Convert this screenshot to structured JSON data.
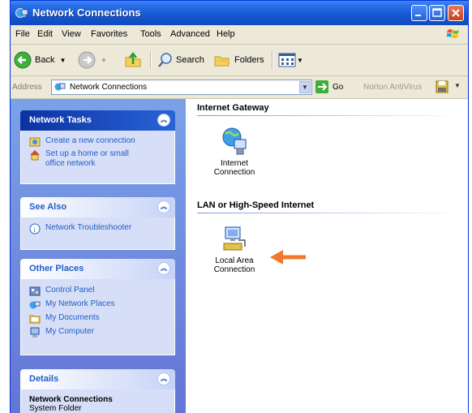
{
  "window": {
    "title": "Network Connections"
  },
  "menu": [
    "File",
    "Edit",
    "View",
    "Favorites",
    "Tools",
    "Advanced",
    "Help"
  ],
  "toolbar": {
    "back": "Back",
    "search": "Search",
    "folders": "Folders"
  },
  "address": {
    "label": "Address",
    "value": "Network Connections",
    "go": "Go",
    "norton": "Norton AntiVirus"
  },
  "tasks": {
    "network_tasks": {
      "title": "Network Tasks",
      "items": [
        "Create a new connection",
        "Set up a home or small office network"
      ]
    },
    "see_also": {
      "title": "See Also",
      "items": [
        "Network Troubleshooter"
      ]
    },
    "other_places": {
      "title": "Other Places",
      "items": [
        "Control Panel",
        "My Network Places",
        "My Documents",
        "My Computer"
      ]
    },
    "details": {
      "title": "Details",
      "name": "Network Connections",
      "subtitle": "System Folder"
    }
  },
  "content": {
    "section1": "Internet Gateway",
    "item1": "Internet Connection",
    "section2": "LAN or High-Speed Internet",
    "item2": "Local Area Connection"
  },
  "colors": {
    "titlebar": "#0f49c0",
    "task_link": "#215dc6",
    "arrow": "#f07a2a"
  }
}
